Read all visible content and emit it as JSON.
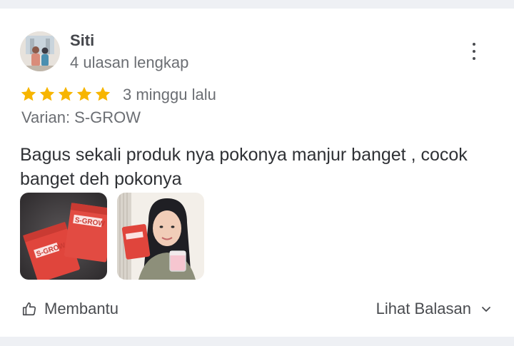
{
  "review": {
    "reviewer_name": "Siti",
    "reviewer_meta": "4 ulasan lengkap",
    "rating": 5,
    "time_ago": "3 minggu lalu",
    "variant": "Varian: S-GROW",
    "text": "Bagus sekali produk nya pokonya manjur banget , cocok banget deh pokonya",
    "photos": [
      {
        "name": "review-photo-product-packs",
        "label": "S-GROW"
      },
      {
        "name": "review-photo-user-with-product",
        "label": "S-GROW"
      }
    ],
    "helpful_label": "Membantu",
    "replies_label": "Lihat Balasan"
  },
  "colors": {
    "star": "#f7b500",
    "card": "#ffffff",
    "background": "#eef0f4",
    "product_red": "#e0453c"
  },
  "icons": {
    "more": "kebab-menu-icon",
    "thumbs_up": "thumbs-up-icon",
    "chevron": "chevron-down-icon",
    "star": "star-icon"
  }
}
